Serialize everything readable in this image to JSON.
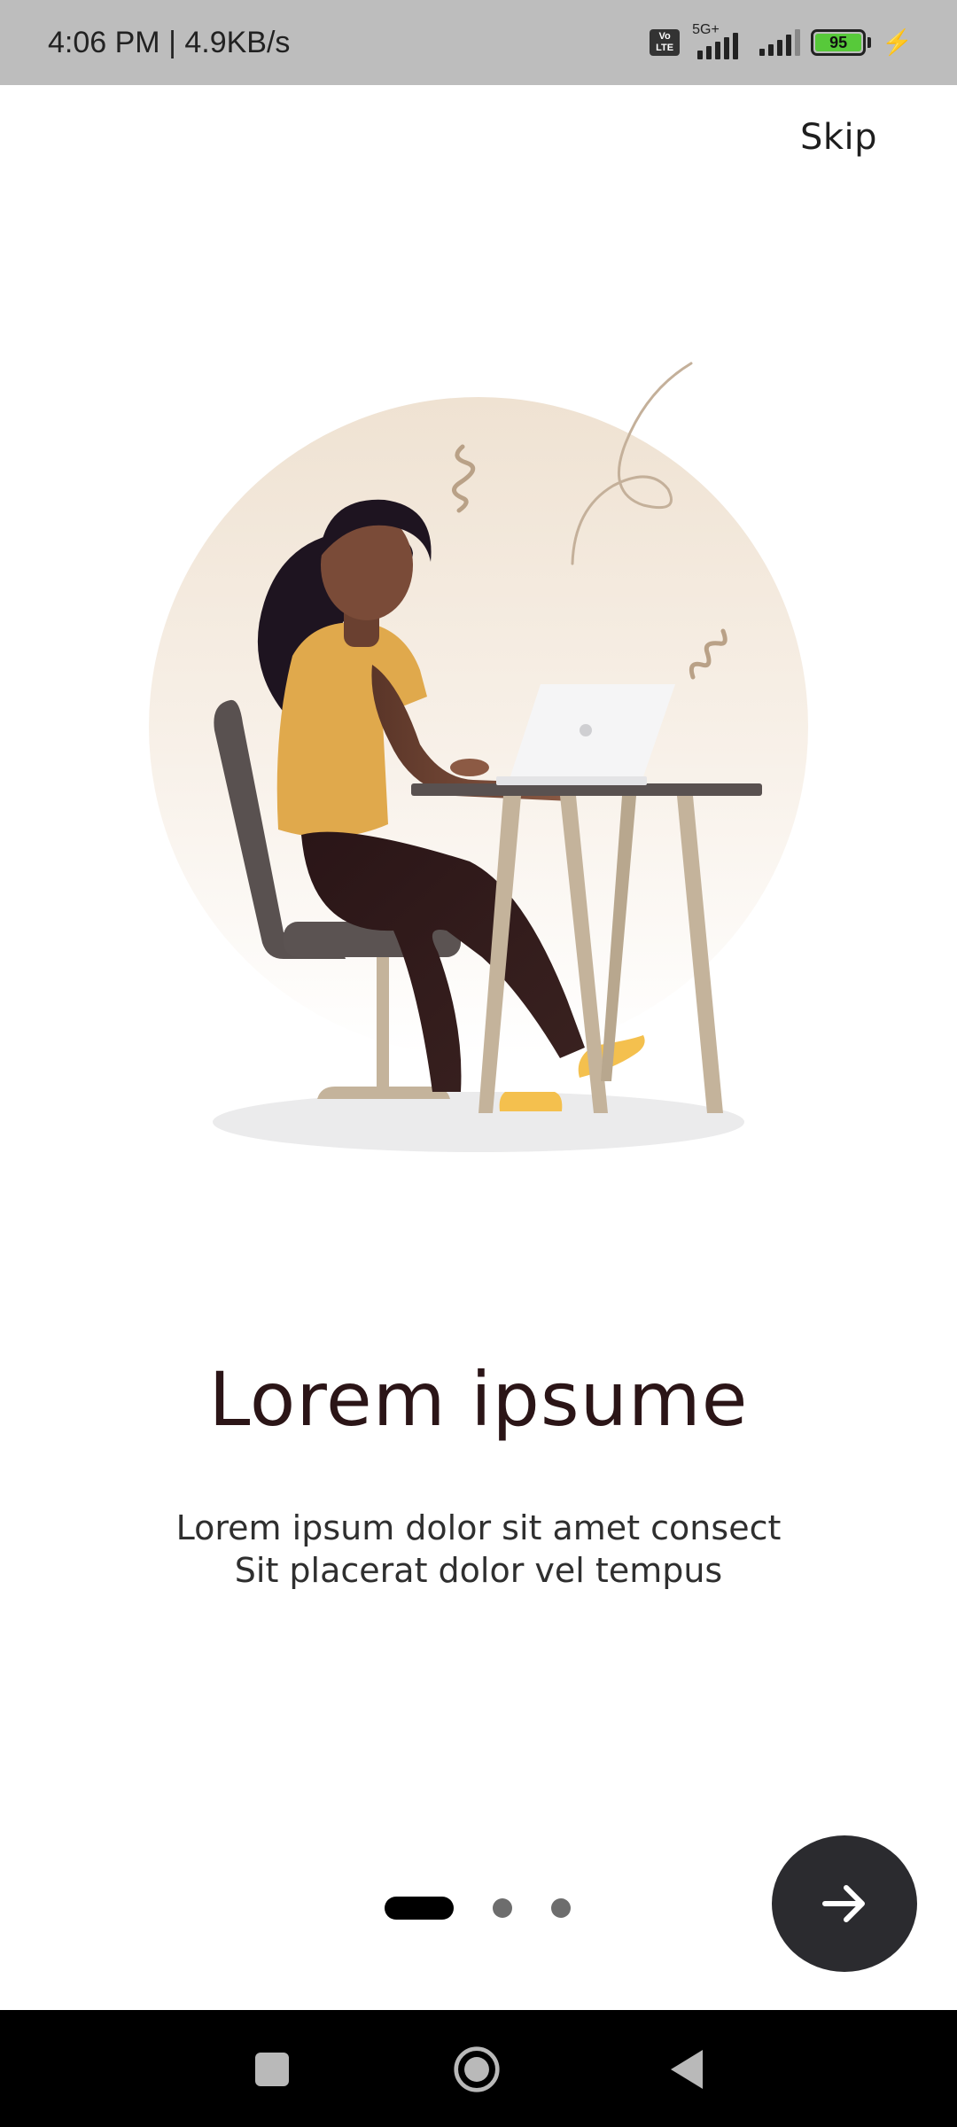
{
  "status_bar": {
    "time_speed": "4:06 PM | 4.9KB/s",
    "volte_line1": "Vo",
    "volte_line2": "LTE",
    "network": "5G+",
    "battery": "95",
    "colors": {
      "background": "#bdbdbd",
      "battery_fill": "#57c93a"
    }
  },
  "header": {
    "skip_label": "Skip"
  },
  "illustration": {
    "name": "woman-at-laptop-desk"
  },
  "content": {
    "title": "Lorem ipsume",
    "description_line1": "Lorem ipsum dolor sit amet consect",
    "description_line2": "Sit placerat dolor vel tempus"
  },
  "pager": {
    "page_count": 3,
    "current_page": 1
  },
  "next_button": {
    "icon": "arrow-right-icon"
  },
  "nav_bar": {
    "recents_icon": "square-icon",
    "home_icon": "circle-icon",
    "back_icon": "triangle-back-icon"
  },
  "colors": {
    "accent_dark": "#2b2b2f",
    "title": "#2b1517"
  }
}
